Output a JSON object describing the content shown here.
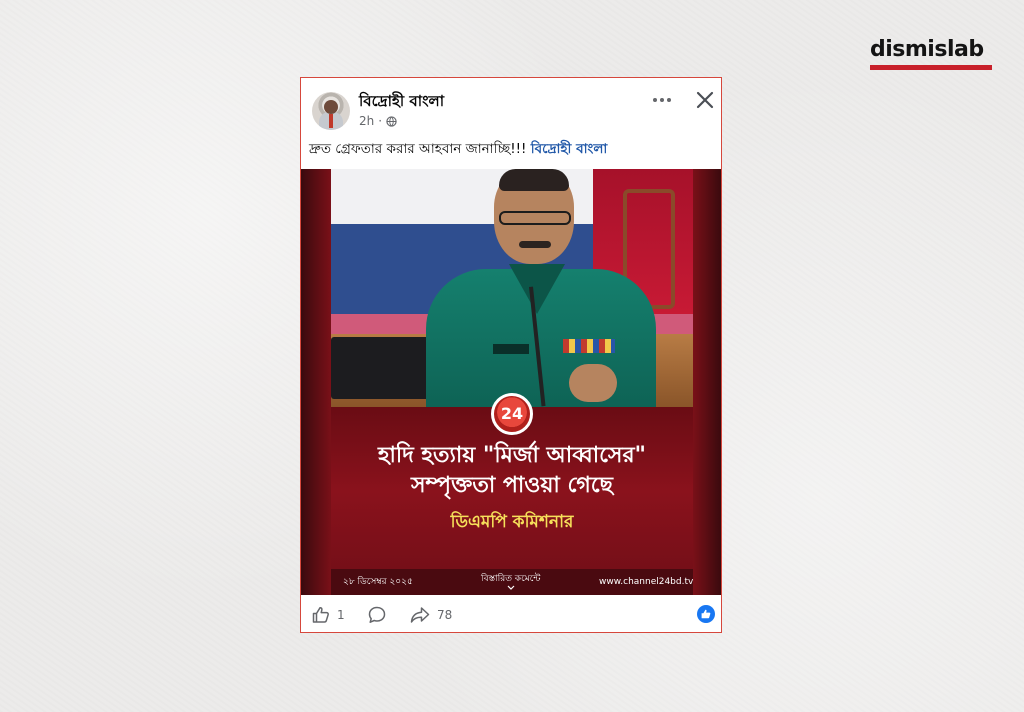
{
  "brand": {
    "name": "dismislab",
    "accent_color": "#c8202a"
  },
  "post": {
    "page_name": "বিদ্রোহী বাংলা",
    "time": "2h",
    "separator": "·",
    "caption_text": "দ্রুত গ্রেফতার করার আহবান জানাচ্ছি!!! ",
    "caption_tag": "বিদ্রোহী বাংলা",
    "media": {
      "channel_logo_text": "24",
      "headline_line1": "হাদি হত্যায় \"মির্জা আব্বাসের\"",
      "headline_line2": "সম্পৃক্ততা পাওয়া গেছে",
      "source": "ডিএমপি কমিশনার",
      "date": "২৮ ডিসেম্বর ২০২৫",
      "details_label": "বিস্তারিত কমেন্টে",
      "website": "www.channel24bd.tv"
    },
    "actions": {
      "like_count": "1",
      "share_count": "78"
    },
    "colors": {
      "link_blue": "#2158a8",
      "like_blue": "#1877f2",
      "border_red": "#d6473c"
    }
  }
}
